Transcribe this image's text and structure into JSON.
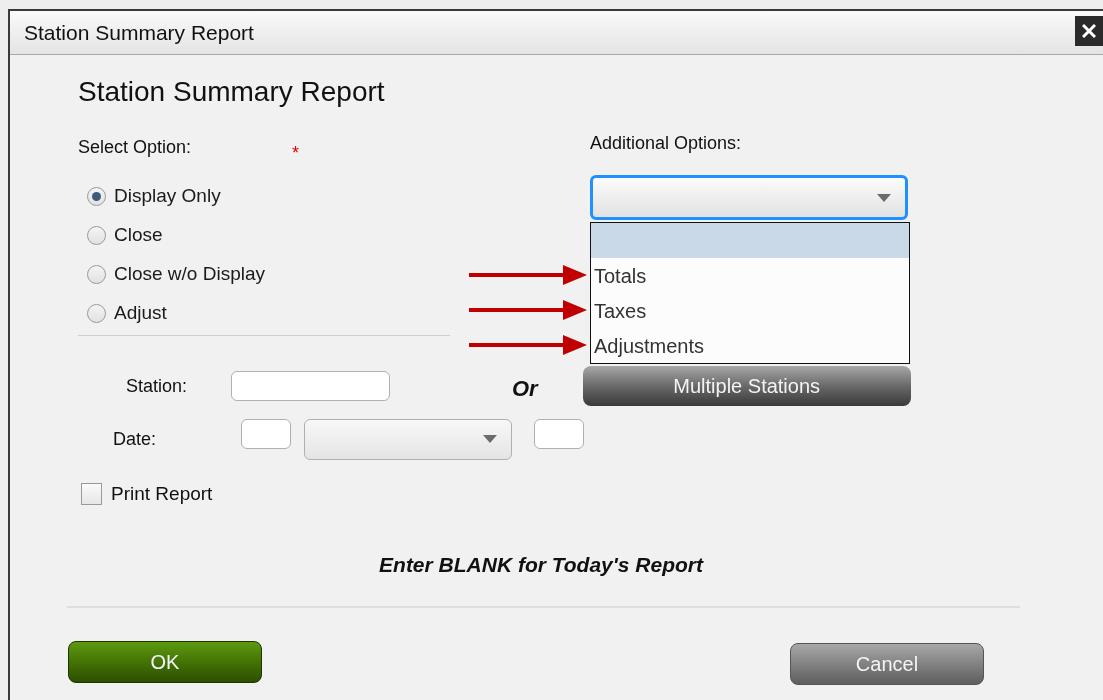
{
  "window": {
    "title": "Station Summary Report"
  },
  "heading": "Station Summary Report",
  "select_option": {
    "label": "Select Option:",
    "required_mark": "*",
    "options": [
      {
        "label": "Display Only",
        "selected": true
      },
      {
        "label": "Close",
        "selected": false
      },
      {
        "label": "Close w/o Display",
        "selected": false
      },
      {
        "label": "Adjust",
        "selected": false
      }
    ]
  },
  "additional_options": {
    "label": "Additional Options:",
    "expanded": true,
    "items": [
      {
        "selected": true,
        "arrow": false
      },
      {
        "label": "Totals",
        "selected": false,
        "arrow": true
      },
      {
        "label": "Taxes",
        "selected": false,
        "arrow": true
      },
      {
        "label": "Adjustments",
        "selected": false,
        "arrow": true
      }
    ]
  },
  "station": {
    "label": "Station:"
  },
  "or_label": "Or",
  "multiple_stations_button": "Multiple Stations",
  "date": {
    "label": "Date:"
  },
  "print_report": {
    "label": "Print Report",
    "checked": false
  },
  "hint": "Enter BLANK for Today's Report",
  "buttons": {
    "ok": "OK",
    "cancel": "Cancel"
  }
}
